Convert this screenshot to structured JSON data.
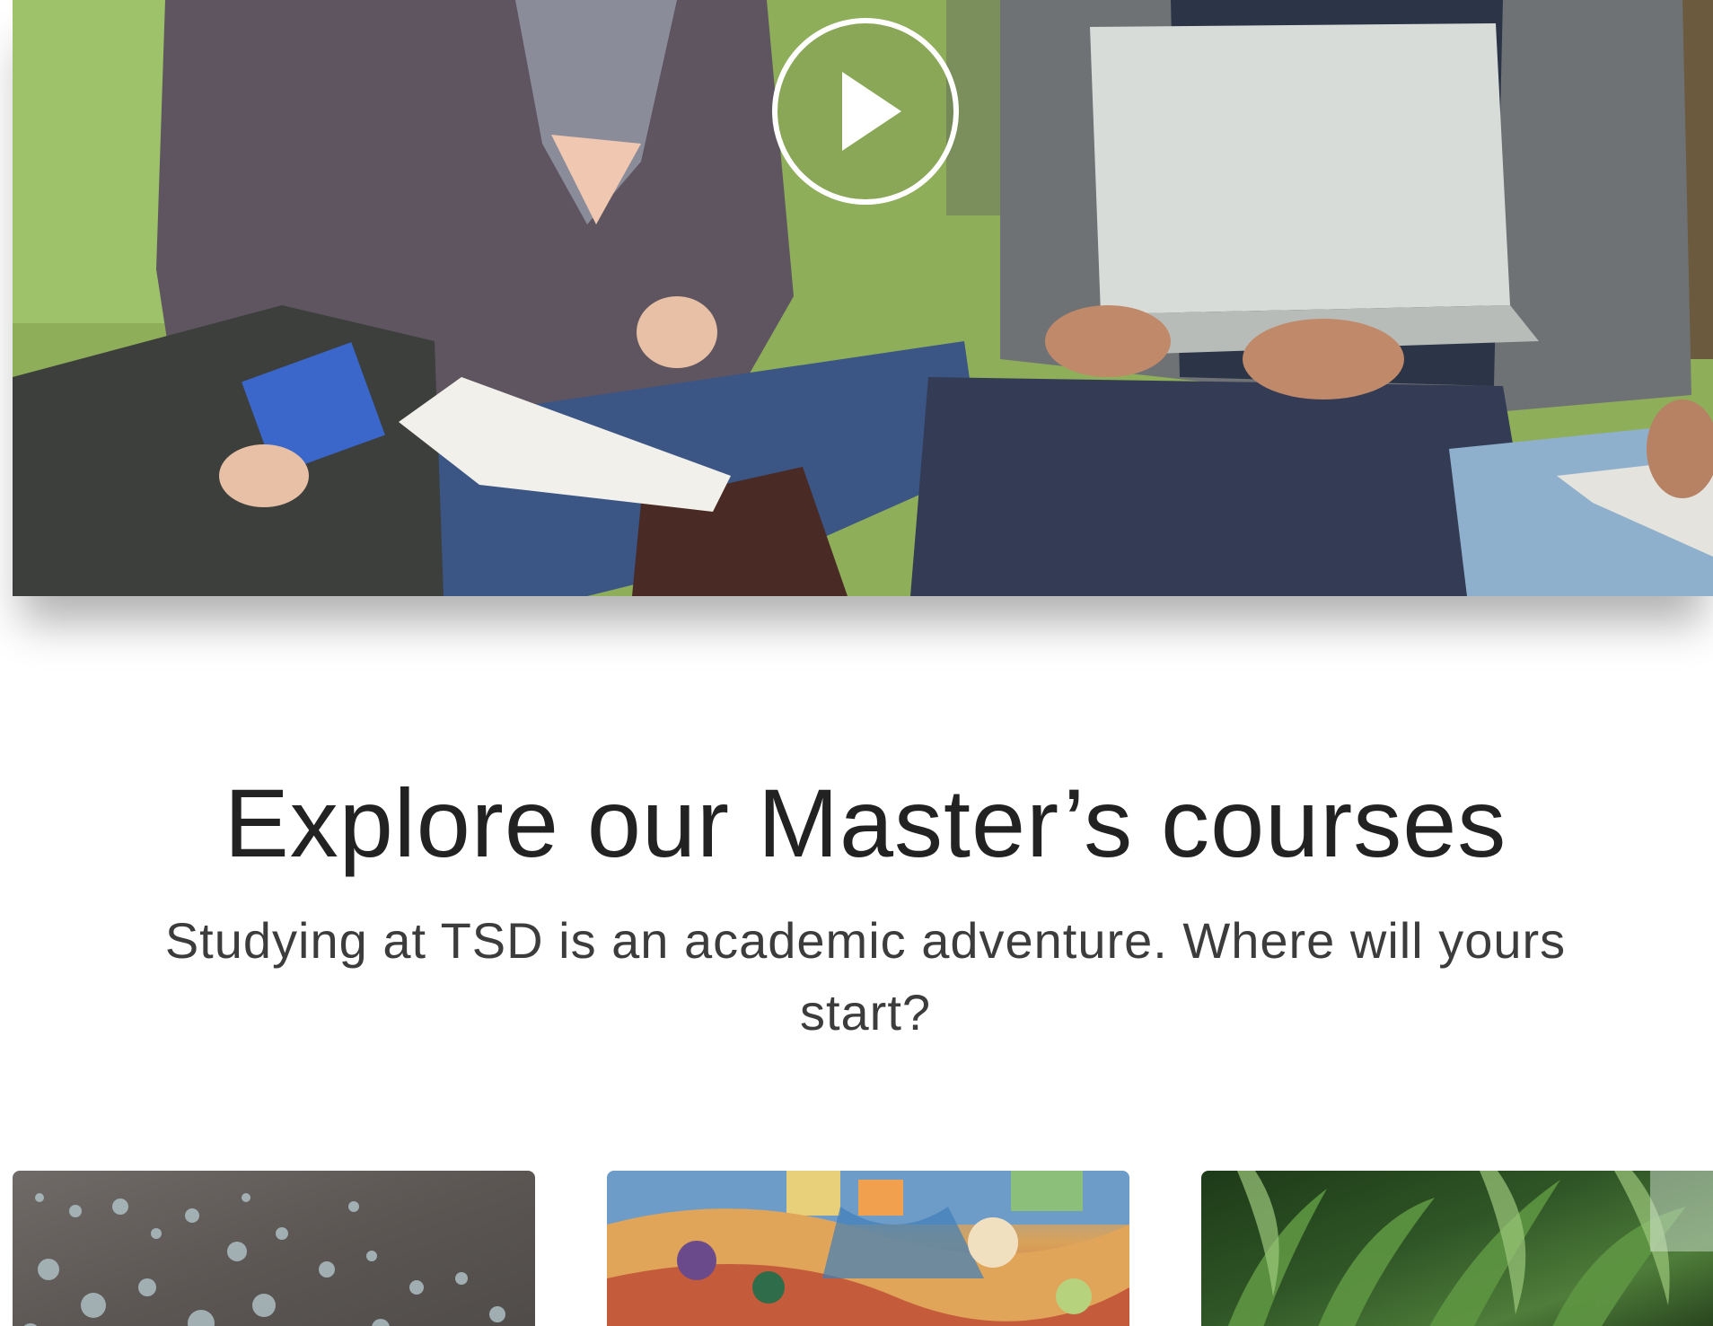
{
  "hero": {
    "media": "video-thumbnail",
    "play_icon": "play-icon",
    "scene": "students-studying-on-grass"
  },
  "courses_section": {
    "title": "Explore our Master’s courses",
    "subtitle": "Studying at TSD is an academic adventure. Where will yours start?"
  },
  "course_cards": [
    {
      "image": "water-droplets"
    },
    {
      "image": "colorful-mural"
    },
    {
      "image": "green-plants"
    }
  ],
  "colors": {
    "title_text": "#222222",
    "subtitle_text": "#3c3c3c",
    "background": "#ffffff",
    "play_button": "#ffffff"
  }
}
